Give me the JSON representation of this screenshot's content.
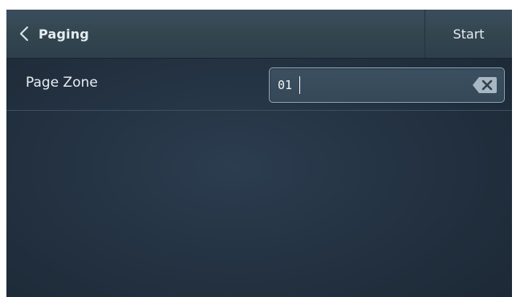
{
  "header": {
    "title": "Paging",
    "start_label": "Start",
    "back_icon": "chevron-left-icon"
  },
  "page_zone": {
    "label": "Page Zone",
    "value": "01",
    "clear_icon": "backspace-clear-icon"
  },
  "colors": {
    "background": "#22303f",
    "header": "#33464f",
    "text": "#e6ecf0",
    "input_border": "#8ea3b4",
    "clear_icon_fill": "#a9b7c3"
  }
}
